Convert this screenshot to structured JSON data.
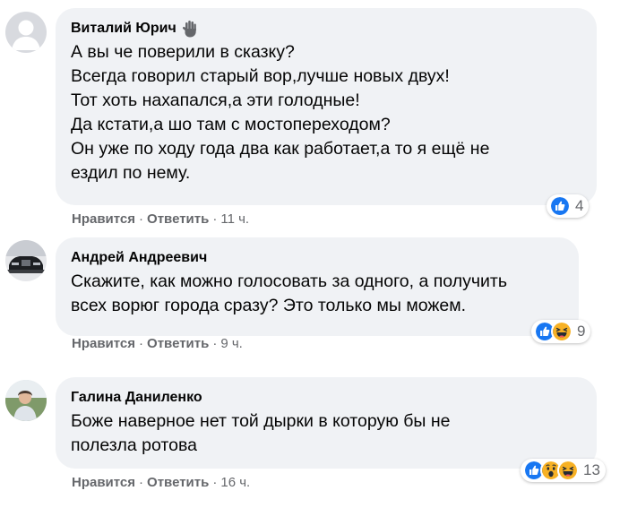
{
  "comments": [
    {
      "author": "Виталий Юрич",
      "badge_icon": "waving-hand-icon",
      "lines": [
        "А вы че поверили в сказку?",
        "Всегда говорил старый вор,лучше новых двух!",
        "Тот хоть нахапался,а эти голодные!",
        "Да кстати,а шо там с мостопереходом?",
        "Он уже по ходу года два как работает,а то я ещё не",
        "ездил по нему."
      ],
      "reaction_icons": [
        "like-icon"
      ],
      "reaction_count": "4",
      "like_label": "Нравится",
      "reply_label": "Ответить",
      "time": "11 ч."
    },
    {
      "author": "Андрей Андреевич",
      "lines": [
        "Скажите, как можно голосовать за одного, а получить",
        "всех ворюг города сразу? Это только мы можем."
      ],
      "reaction_icons": [
        "like-icon",
        "haha-icon"
      ],
      "reaction_count": "9",
      "like_label": "Нравится",
      "reply_label": "Ответить",
      "time": "9 ч."
    },
    {
      "author": "Галина Даниленко",
      "lines": [
        "Боже наверное нет той дырки в которую бы не",
        "полезла ротова"
      ],
      "reaction_icons": [
        "like-icon",
        "wow-icon",
        "haha-icon"
      ],
      "reaction_count": "13",
      "like_label": "Нравится",
      "reply_label": "Ответить",
      "time": "16 ч."
    }
  ],
  "separator": "·",
  "colors": {
    "bubble": "#f0f2f5",
    "text": "#050505",
    "secondary": "#65676b",
    "like_blue": "#1877f2",
    "emoji_yellow": "#f7b125"
  }
}
